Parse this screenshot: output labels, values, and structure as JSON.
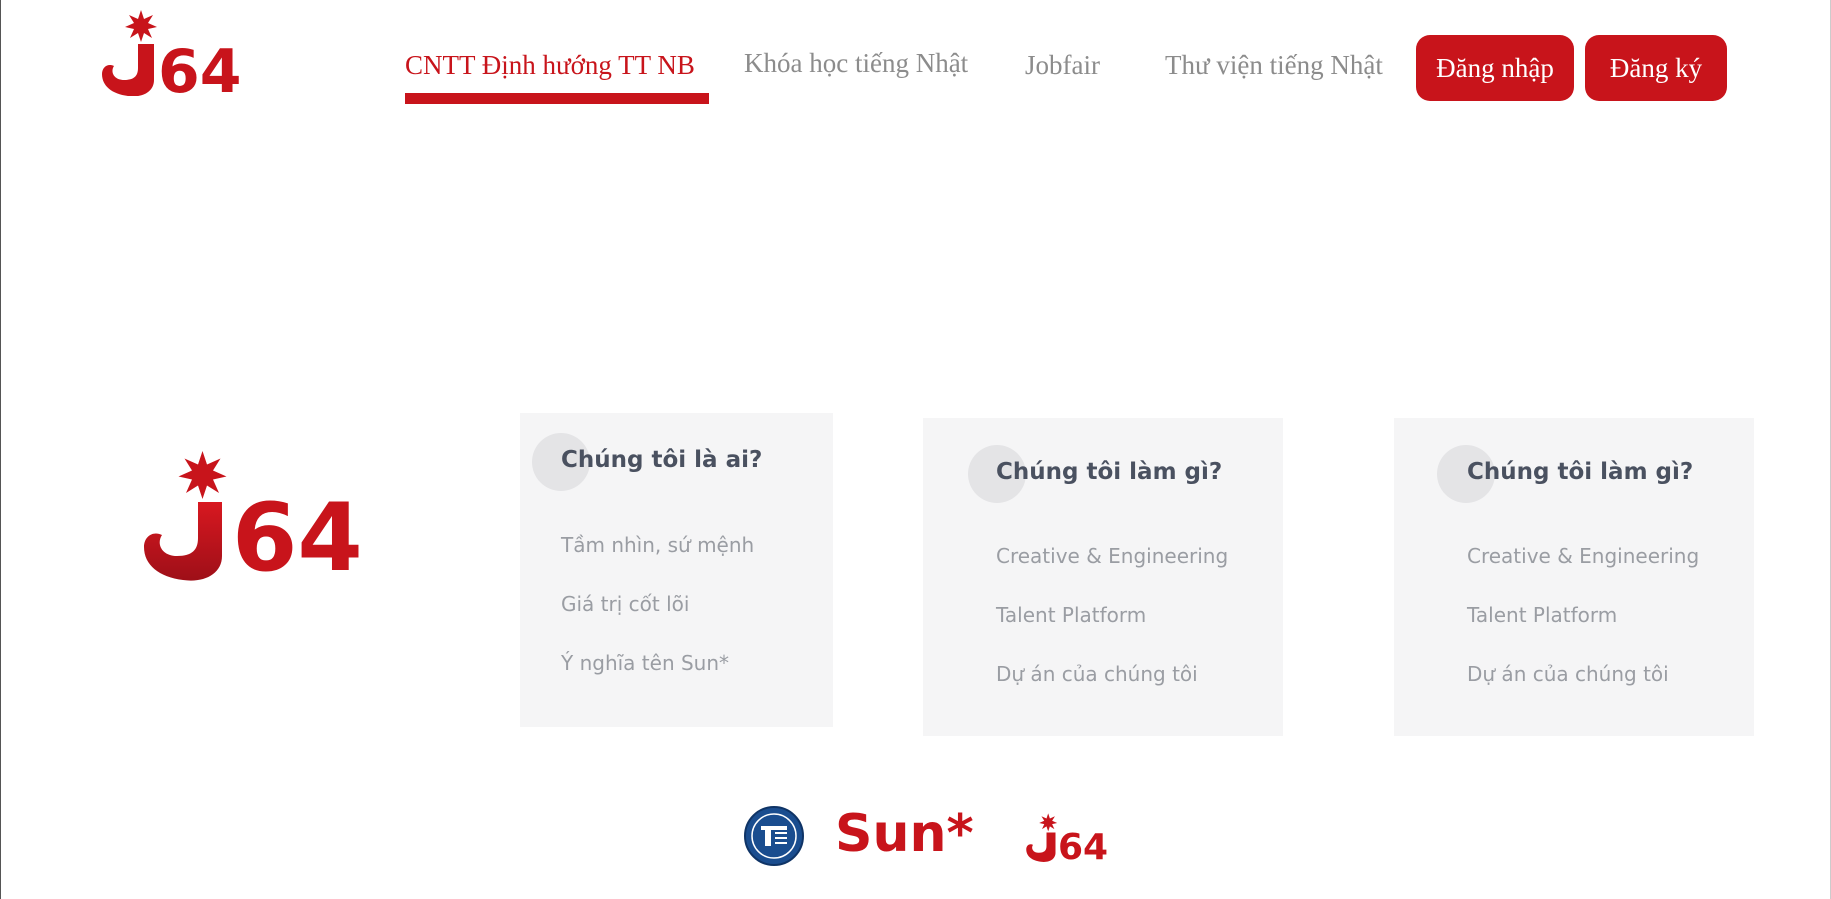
{
  "brand": {
    "logo_text": "64",
    "accent_color": "#c8141b"
  },
  "nav": {
    "items": [
      {
        "label": "CNTT Định hướng TT NB",
        "active": true
      },
      {
        "label": "Khóa học tiếng Nhật",
        "active": false
      },
      {
        "label": "Jobfair",
        "active": false
      },
      {
        "label": "Thư viện tiếng Nhật",
        "active": false
      }
    ],
    "login_label": "Đăng nhập",
    "register_label": "Đăng ký"
  },
  "cards": [
    {
      "title": "Chúng tôi là ai?",
      "links": [
        "Tầm nhìn, sứ mệnh",
        "Giá trị cốt lõi",
        "Ý nghĩa tên Sun*"
      ]
    },
    {
      "title": "Chúng tôi làm gì?",
      "links": [
        "Creative & Engineering",
        "Talent Platform",
        "Dự án của chúng tôi"
      ]
    },
    {
      "title": "Chúng tôi làm gì?",
      "links": [
        "Creative & Engineering",
        "Talent Platform",
        "Dự án của chúng tôi"
      ]
    }
  ],
  "footer": {
    "sun_logo": "Sun*",
    "j64_logo": "64",
    "uet_seal_icon": "university-seal-icon"
  }
}
